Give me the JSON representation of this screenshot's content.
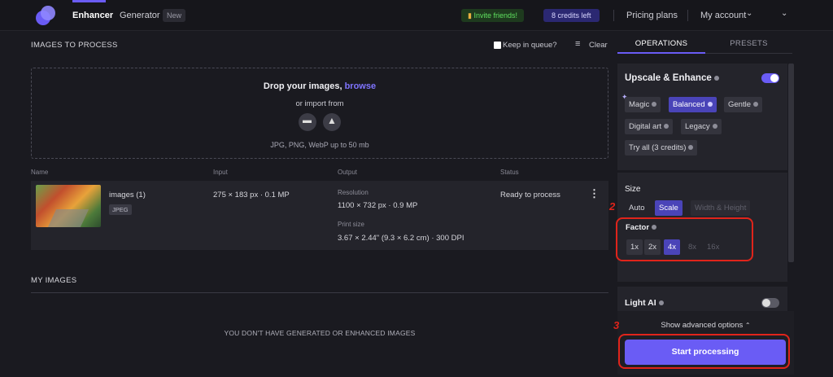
{
  "nav": {
    "tab_enhancer": "Enhancer",
    "tab_generator": "Generator",
    "new_badge": "New",
    "invite": "Invite friends!",
    "credits": "8 credits left",
    "pricing": "Pricing plans",
    "account": "My account"
  },
  "images": {
    "title": "IMAGES TO PROCESS",
    "keep_queue": "Keep in queue?",
    "clear": "Clear",
    "drop_text": "Drop your images,",
    "browse": "browse",
    "import_from": "or import from",
    "formats": "JPG, PNG, WebP up to 50 mb",
    "columns": {
      "name": "Name",
      "input": "Input",
      "output": "Output",
      "status": "Status"
    },
    "row": {
      "name": "images (1)",
      "type": "JPEG",
      "input": "275 × 183 px · 0.1 MP",
      "resolution_label": "Resolution",
      "resolution": "1100 × 732 px · 0.9 MP",
      "print_label": "Print size",
      "print": "3.67 × 2.44\" (9.3 × 6.2 cm) · 300 DPI",
      "status": "Ready to process"
    }
  },
  "my_images": {
    "title": "MY IMAGES",
    "empty": "YOU DON'T HAVE GENERATED OR ENHANCED IMAGES"
  },
  "panel": {
    "tab_operations": "OPERATIONS",
    "tab_presets": "PRESETS",
    "upscale_title": "Upscale & Enhance",
    "models": [
      "Magic",
      "Balanced",
      "Gentle",
      "Digital art",
      "Legacy",
      "Try all (3 credits)"
    ],
    "size_title": "Size",
    "size_modes": [
      "Auto",
      "Scale",
      "Width & Height"
    ],
    "factor_title": "Factor",
    "factors": [
      "1x",
      "2x",
      "4x",
      "8x",
      "16x"
    ],
    "light_ai": "Light AI",
    "advanced": "Show advanced options",
    "start": "Start processing",
    "annot_2": "2",
    "annot_3": "3"
  },
  "colors": {
    "accent": "#6a5cf5",
    "annotation": "#e0241b"
  }
}
